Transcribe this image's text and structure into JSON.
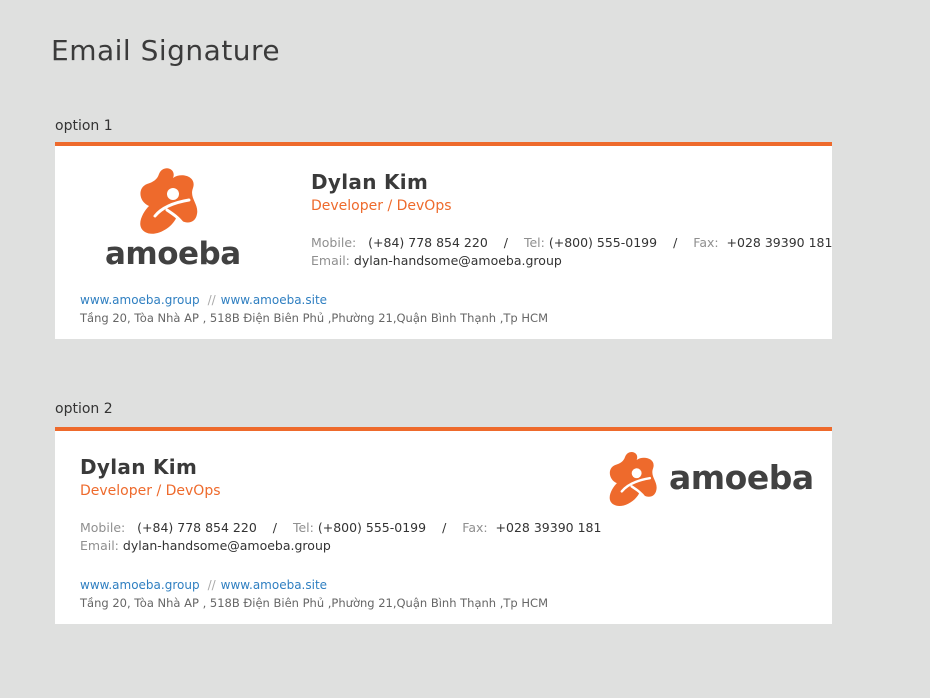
{
  "page": {
    "title": "Email Signature"
  },
  "brand": {
    "accent": "#ee6a2c",
    "link_color": "#2f7fc1",
    "logo_text": "amoeba"
  },
  "options": [
    {
      "label": "option 1",
      "name": "Dylan Kim",
      "role": "Developer / DevOps",
      "mobile_label": "Mobile:",
      "mobile": "(+84) 778 854 220",
      "tel_label": "Tel:",
      "tel": "(+800) 555-0199",
      "fax_label": "Fax:",
      "fax": "+028 39390 181",
      "email_label": "Email:",
      "email": "dylan-handsome@amoeba.group",
      "link1": "www.amoeba.group",
      "link_sep": "//",
      "link2": "www.amoeba.site",
      "address": "Tầng 20, Tòa Nhà AP , 518B Điện Biên Phủ ,Phường 21,Quận Bình Thạnh ,Tp HCM"
    },
    {
      "label": "option 2",
      "name": "Dylan Kim",
      "role": "Developer / DevOps",
      "mobile_label": "Mobile:",
      "mobile": "(+84) 778 854 220",
      "tel_label": "Tel:",
      "tel": "(+800) 555-0199",
      "fax_label": "Fax:",
      "fax": "+028 39390 181",
      "email_label": "Email:",
      "email": "dylan-handsome@amoeba.group",
      "link1": "www.amoeba.group",
      "link_sep": "//",
      "link2": "www.amoeba.site",
      "address": "Tầng 20, Tòa Nhà AP , 518B Điện Biên Phủ ,Phường 21,Quận Bình Thạnh ,Tp HCM"
    }
  ],
  "separator": "/"
}
